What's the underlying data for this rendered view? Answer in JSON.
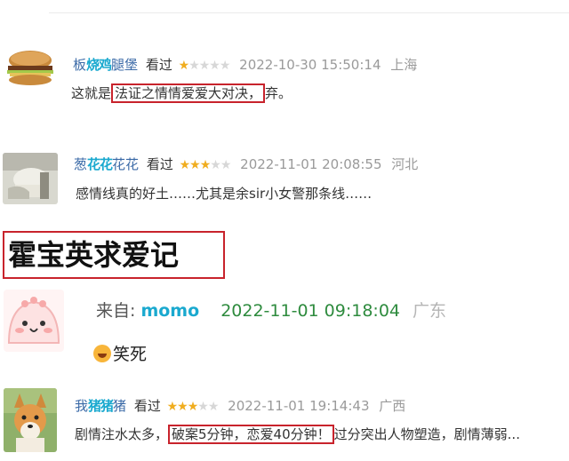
{
  "comments": [
    {
      "user_a": "板",
      "user_blur": "烧鸡",
      "user_b": "腿堡",
      "watched": "看过",
      "stars": "★☆☆☆☆",
      "rating": 1,
      "time": "2022-10-30 15:50:14",
      "location": "上海",
      "text_before": "这就是",
      "text_highlight": "法证之情情爱爱大对决，",
      "text_after": "弃。"
    },
    {
      "user_a": "葱",
      "user_blur": "花花",
      "user_b": "花花",
      "watched": "看过",
      "stars": "★★★☆☆",
      "rating": 3,
      "time": "2022-11-01 20:08:55",
      "location": "河北",
      "text": "感情线真的好土……尤其是余sir小女警那条线……"
    }
  ],
  "section_heading": "霍宝英求爱记",
  "weibo_comment": {
    "from_label": "来自:",
    "from_name": "momo",
    "time": "2022-11-01 09:18:04",
    "location": "广东",
    "emoji": "hugging-face-emoji",
    "text": "笑死"
  },
  "last_comment": {
    "user_a": "我",
    "user_blur": "猪猪",
    "user_b": "猪",
    "watched": "看过",
    "stars": "★★★☆☆",
    "rating": 3,
    "time": "2022-11-01 19:14:43",
    "location": "广西",
    "text_before": "剧情注水太多，",
    "text_highlight": "破案5分钟，恋爱40分钟！",
    "text_after": "过分突出人物塑造，剧情薄弱..."
  },
  "colors": {
    "highlight_border": "#c8232c",
    "username": "#3b6aa7",
    "star": "#f0ad1f",
    "time_green": "#2e8b3e"
  }
}
